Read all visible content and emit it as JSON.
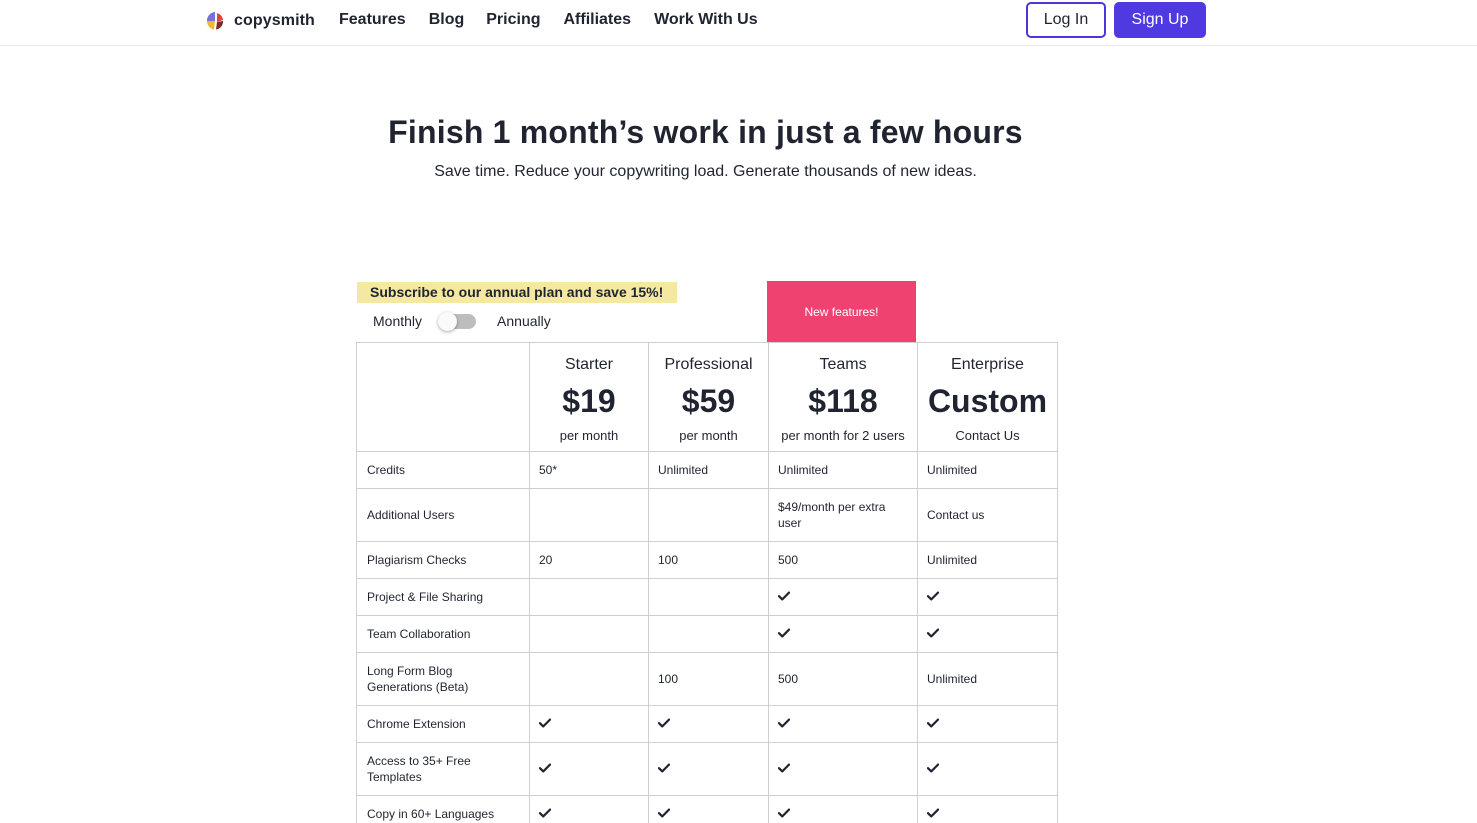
{
  "nav": {
    "brand": "copysmith",
    "links": [
      "Features",
      "Blog",
      "Pricing",
      "Affiliates",
      "Work With Us"
    ],
    "login_label": "Log In",
    "signup_label": "Sign Up"
  },
  "hero": {
    "title": "Finish 1 month’s work in just a few hours",
    "subtitle": "Save time. Reduce your copywriting load. Generate thousands of new ideas."
  },
  "billing": {
    "promo": "Subscribe to our annual plan and save 15%!",
    "monthly_label": "Monthly",
    "annually_label": "Annually",
    "annual_selected": false
  },
  "new_badge": "New features!",
  "plans": [
    {
      "name": "Starter",
      "price": "$19",
      "period": "per month"
    },
    {
      "name": "Professional",
      "price": "$59",
      "period": "per month"
    },
    {
      "name": "Teams",
      "price": "$118",
      "period": "per month for 2 users"
    },
    {
      "name": "Enterprise",
      "price": "Custom",
      "period": "Contact Us"
    }
  ],
  "features": [
    {
      "label": "Credits",
      "values": [
        "50*",
        "Unlimited",
        "Unlimited",
        "Unlimited"
      ]
    },
    {
      "label": "Additional Users",
      "values": [
        "",
        "",
        "$49/month per extra user",
        "Contact us"
      ]
    },
    {
      "label": "Plagiarism Checks",
      "values": [
        "20",
        "100",
        "500",
        "Unlimited"
      ]
    },
    {
      "label": "Project & File Sharing",
      "values": [
        "",
        "",
        "✔",
        "✔"
      ]
    },
    {
      "label": "Team Collaboration",
      "values": [
        "",
        "",
        "✔",
        "✔"
      ]
    },
    {
      "label": "Long Form Blog Generations (Beta)",
      "values": [
        "",
        "100",
        "500",
        "Unlimited"
      ]
    },
    {
      "label": "Chrome Extension",
      "values": [
        "✔",
        "✔",
        "✔",
        "✔"
      ]
    },
    {
      "label": "Access to 35+ Free Templates",
      "values": [
        "✔",
        "✔",
        "✔",
        "✔"
      ]
    },
    {
      "label": "Copy in 60+ Languages",
      "values": [
        "✔",
        "✔",
        "✔",
        "✔"
      ]
    }
  ],
  "colors": {
    "accent": "#4f39e0",
    "badge": "#ef4271",
    "promo_bg": "#f5e8a0"
  }
}
